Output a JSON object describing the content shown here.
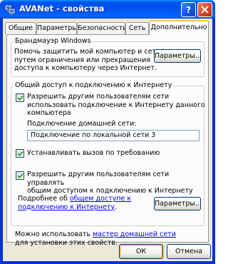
{
  "window": {
    "title": "AVANet - свойства",
    "help_label": "?",
    "close_label": "✕"
  },
  "tabs": [
    "Общие",
    "Параметры",
    "Безопасность",
    "Сеть",
    "Дополнительно"
  ],
  "active_tab": "Дополнительно",
  "firewall": {
    "legend": "Брандмауэр Windows",
    "description_lines": [
      "Помочь защитить мой компьютер и сеть",
      "путем ограничения или прекращения",
      "доступа к компьютеру через Интернет."
    ],
    "settings_button": "Параметры..."
  },
  "ics": {
    "legend": "Общий доступ к подключению к Интернету",
    "allow_share": {
      "checked": true,
      "label_lines": [
        "Разрешить другим пользователям сети",
        "использовать подключение к Интернету данного",
        "компьютера"
      ]
    },
    "home_connection_label": "Подключение домашней сети:",
    "home_connection_value": "Подключение по локальной сети 3",
    "dial_on_demand": {
      "checked": true,
      "label": "Устанавливать вызов по требованию"
    },
    "allow_control": {
      "checked": true,
      "label_lines": [
        "Разрешить другим пользователям сети управлять",
        "общим доступом к подключению к Интернету"
      ]
    },
    "more_info_prefix": "Подробнее об ",
    "more_info_link_line1": "общем доступе к",
    "more_info_link_line2": "подключению к Интернету",
    "more_info_suffix": ".",
    "settings_button": "Параметры..."
  },
  "footer": {
    "line1_prefix": "Можно использовать ",
    "line1_link": "мастер домашней сети",
    "line2": "для установки этих свойств."
  },
  "buttons": {
    "ok": "ОК",
    "cancel": "Отмена"
  },
  "colors": {
    "title_bar": "#0054e3",
    "dialog_face": "#ece9d8",
    "tab_page": "#fcfcfe",
    "active_tab_accent": "#ffc83c",
    "link": "#0000ff",
    "close_button": "#d8472a"
  },
  "icons": {
    "app": "network-connection-icon",
    "help": "question-mark-icon",
    "close": "close-x-icon",
    "check": "checkmark-icon"
  }
}
